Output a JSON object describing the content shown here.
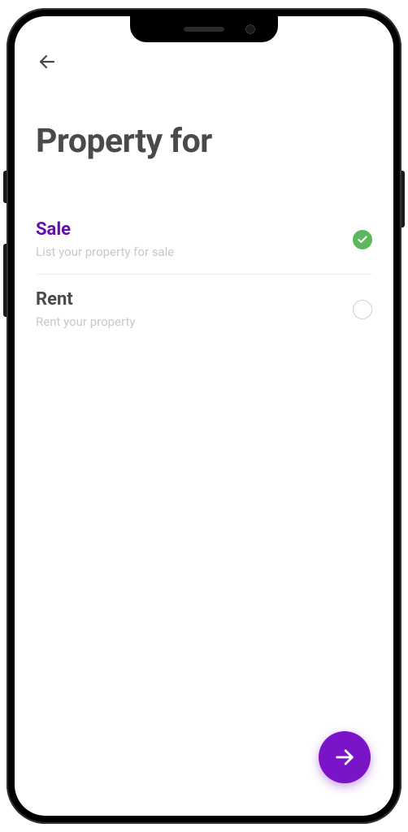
{
  "title": "Property for",
  "options": [
    {
      "title": "Sale",
      "desc": "List your property for sale",
      "selected": true
    },
    {
      "title": "Rent",
      "desc": "Rent your property",
      "selected": false
    }
  ]
}
